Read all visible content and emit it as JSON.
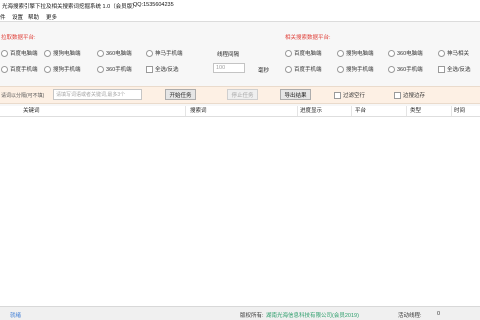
{
  "window": {
    "title": "光海搜索引擎下拉及相关搜索词挖掘系统 1.0（会员版）",
    "qq": "QQ:1535604235"
  },
  "menu": [
    "件",
    "设置",
    "帮助",
    "更多"
  ],
  "left_group": {
    "title": "拉取数据平台:",
    "row1": [
      "百度电脑端",
      "搜狗电脑端",
      "360电脑端",
      "神马手机端"
    ],
    "row2": [
      "百度手机端",
      "搜狗手机端",
      "360手机端"
    ],
    "select_all": "全选/反选",
    "interval_label": "线程间隔",
    "interval_value": "100",
    "interval_unit": "毫秒"
  },
  "right_group": {
    "title": "相关搜索数据平台:",
    "row1": [
      "百度电脑端",
      "搜狗电脑端",
      "360电脑端",
      "神马相关"
    ],
    "row2": [
      "百度手机端",
      "搜狗手机端",
      "360手机端"
    ],
    "select_all": "全选/反选"
  },
  "toolbar": {
    "keyword_label": "请词以分隔(可不填)",
    "keyword_placeholder": "请填写词语或者关键词,最多3个",
    "start": "开始任务",
    "stop": "停止任务",
    "export": "导出结果",
    "filter_empty": "过滤空行",
    "save_while": "边搜边存"
  },
  "table": {
    "columns": [
      "关键词",
      "搜索词",
      "进度显示",
      "平台",
      "类型",
      "时间"
    ]
  },
  "status": {
    "ready": "就绪",
    "copyright_label": "版权所有:",
    "company": "湖南光海信息科技有限公司(会员2019)",
    "threads_label": "活动线程:",
    "threads_value": "0"
  },
  "colors": {
    "group_title": "#e0413a",
    "toolbar_band": "#fdf0e4",
    "status_ready": "#3a7bd5",
    "company_link": "#2a9d6a"
  }
}
